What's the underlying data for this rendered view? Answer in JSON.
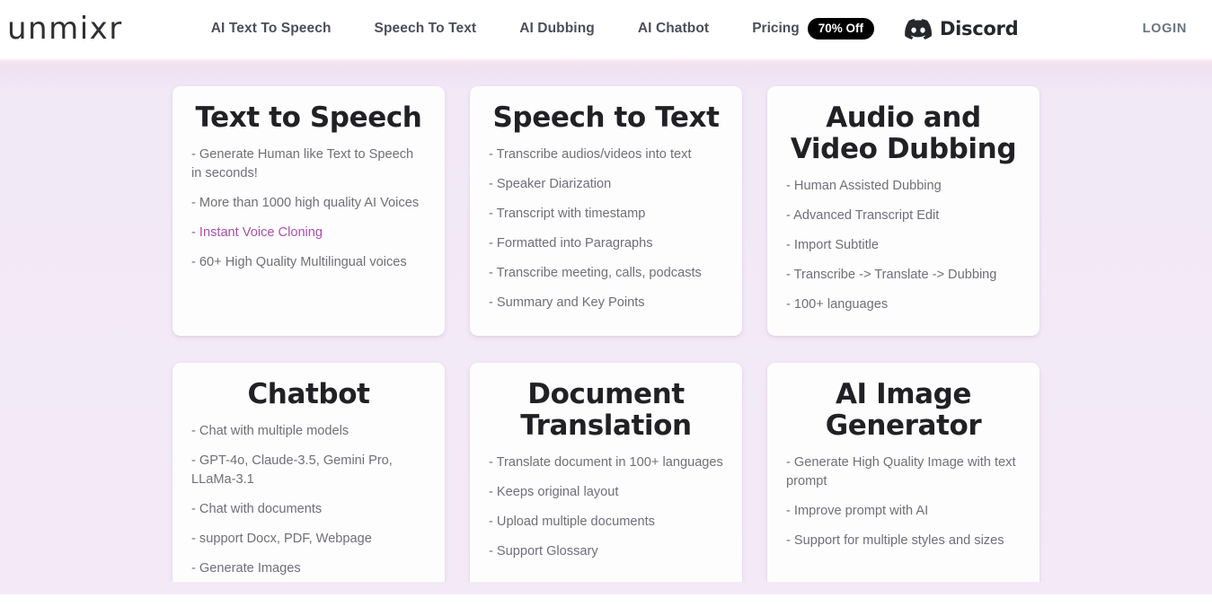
{
  "header": {
    "logo": "unmixr",
    "nav": [
      {
        "label": "AI Text To Speech"
      },
      {
        "label": "Speech To Text"
      },
      {
        "label": "AI Dubbing"
      },
      {
        "label": "AI Chatbot"
      }
    ],
    "pricing": {
      "label": "Pricing",
      "badge": "70% Off",
      "badge_bg": "#000000",
      "badge_color": "#ffffff"
    },
    "discord": {
      "label": "Discord",
      "icon": "discord-icon"
    },
    "login": "LOGIN"
  },
  "theme": {
    "background": "#f4eaf7",
    "card_background": "#fdfdfd",
    "link_color": "#ab4fad",
    "body_text": "#6f6f78",
    "title_text": "#212125",
    "nav_text": "#4b4f5c",
    "login_text": "#6b7280"
  },
  "cards": [
    {
      "title": "Text to Speech",
      "items": [
        {
          "text": "- Generate Human like Text to Speech in seconds!",
          "link": false
        },
        {
          "text": "- More than 1000 high quality AI Voices",
          "link": false
        },
        {
          "prefix": "- ",
          "text": "Instant Voice Cloning",
          "link": true
        },
        {
          "text": "- 60+ High Quality Multilingual voices",
          "link": false
        }
      ]
    },
    {
      "title": "Speech to Text",
      "items": [
        {
          "text": "- Transcribe audios/videos into text",
          "link": false
        },
        {
          "text": "- Speaker Diarization",
          "link": false
        },
        {
          "text": "- Transcript with timestamp",
          "link": false
        },
        {
          "text": "- Formatted into Paragraphs",
          "link": false
        },
        {
          "text": "- Transcribe meeting, calls, podcasts",
          "link": false
        },
        {
          "text": "- Summary and Key Points",
          "link": false
        }
      ]
    },
    {
      "title": "Audio and Video Dubbing",
      "items": [
        {
          "text": "- Human Assisted Dubbing",
          "link": false
        },
        {
          "text": "- Advanced Transcript Edit",
          "link": false
        },
        {
          "text": "- Import Subtitle",
          "link": false
        },
        {
          "text": "- Transcribe -> Translate -> Dubbing",
          "link": false
        },
        {
          "text": "- 100+ languages",
          "link": false
        }
      ]
    },
    {
      "title": "Chatbot",
      "items": [
        {
          "text": "- Chat with multiple models",
          "link": false
        },
        {
          "text": "- GPT-4o, Claude-3.5, Gemini Pro, LLaMa-3.1",
          "link": false
        },
        {
          "text": "- Chat with documents",
          "link": false
        },
        {
          "text": "- support Docx, PDF, Webpage",
          "link": false
        },
        {
          "text": "- Generate Images",
          "link": false
        }
      ]
    },
    {
      "title": "Document Translation",
      "items": [
        {
          "text": "- Translate document in 100+ languages",
          "link": false
        },
        {
          "text": "- Keeps original layout",
          "link": false
        },
        {
          "text": "- Upload multiple documents",
          "link": false
        },
        {
          "text": "- Support Glossary",
          "link": false
        }
      ]
    },
    {
      "title": "AI Image Generator",
      "items": [
        {
          "text": "- Generate High Quality Image with text prompt",
          "link": false
        },
        {
          "text": "- Improve prompt with AI",
          "link": false
        },
        {
          "text": "- Support for multiple styles and sizes",
          "link": false
        }
      ]
    }
  ]
}
